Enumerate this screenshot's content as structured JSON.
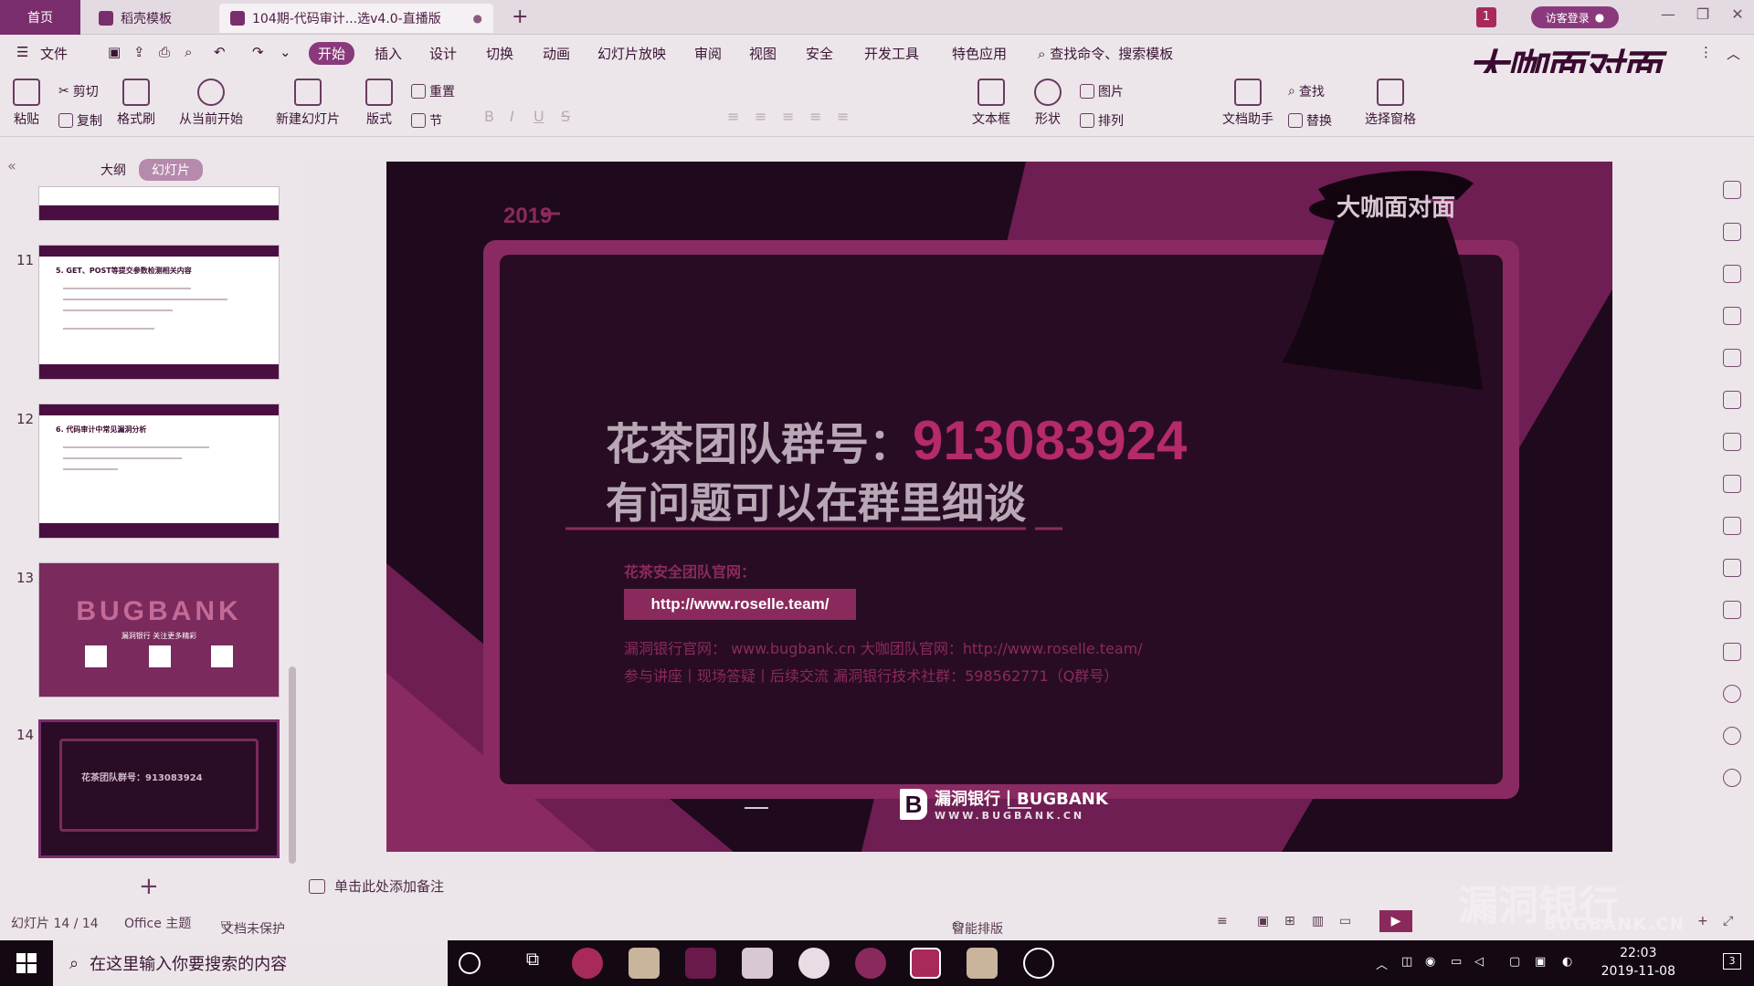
{
  "titlebar": {
    "home_tab": "首页",
    "tabs": [
      {
        "label": "稻壳模板"
      },
      {
        "label": "104期-代码审计...选v4.0-直播版"
      }
    ],
    "new_tab": "+",
    "notification_count": "1",
    "login_label": "访客登录"
  },
  "menubar": {
    "file": "文件",
    "items": [
      "开始",
      "插入",
      "设计",
      "切换",
      "动画",
      "幻灯片放映",
      "审阅",
      "视图",
      "安全",
      "开发工具",
      "特色应用"
    ],
    "active": "开始",
    "search_placeholder": "查找命令、搜索模板"
  },
  "ribbon": {
    "paste": "粘贴",
    "cut": "剪切",
    "copy": "复制",
    "format_painter": "格式刷",
    "from_current": "从当前开始",
    "new_slide": "新建幻灯片",
    "layout": "版式",
    "reset": "重置",
    "section": "节",
    "textbox": "文本框",
    "shape": "形状",
    "picture": "图片",
    "arrange": "排列",
    "doc_assistant": "文档助手",
    "find": "查找",
    "replace": "替换",
    "select_pane": "选择窗格"
  },
  "watermark_top": "大咖面对面",
  "left_panel": {
    "tab_outline": "大纲",
    "tab_slides": "幻灯片",
    "slides": [
      {
        "num": "11",
        "title": "5. GET、POST等提交参数检测相关内容"
      },
      {
        "num": "12",
        "title": "6. 代码审计中常见漏洞分析"
      },
      {
        "num": "13",
        "title": "BUGBANK"
      },
      {
        "num": "14",
        "title": "花茶团队群号：913083924"
      }
    ],
    "thumb13_sub": "漏洞银行 关注更多精彩"
  },
  "slide": {
    "year": "2019",
    "group_label": "花茶团队群号：",
    "group_number": "913083924",
    "subtitle": "有问题可以在群里细谈",
    "official_label": "花茶安全团队官网：",
    "official_url": "http://www.roselle.team/",
    "info_line1": "漏洞银行官网： www.bugbank.cn   大咖团队官网：http://www.roselle.team/",
    "info_line2": "参与讲座丨现场答疑丨后续交流  漏洞银行技术社群：598562771（Q群号）",
    "logo_mark": "B",
    "logo_text": "漏洞银行丨BUGBANK",
    "logo_url": "WWW.BUGBANK.CN",
    "watermark": "大咖面对面"
  },
  "notes_placeholder": "单击此处添加备注",
  "status": {
    "slide_counter": "幻灯片 14 / 14",
    "theme": "Office 主题",
    "protection": "文档未保护",
    "smart_layout": "智能排版"
  },
  "bottom_watermark": {
    "cn": "漏洞银行",
    "en": "BUGBANK.CN"
  },
  "taskbar": {
    "search_placeholder": "在这里输入你要搜索的内容",
    "time": "22:03",
    "date": "2019-11-08",
    "notifications": "3"
  }
}
